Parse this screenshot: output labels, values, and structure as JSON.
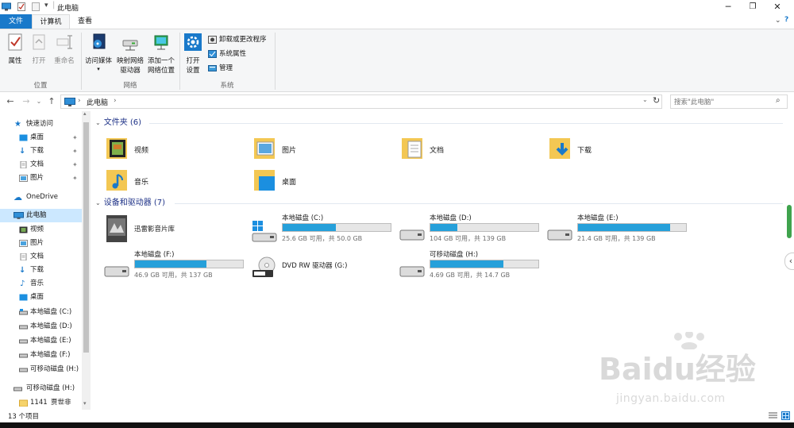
{
  "window": {
    "title": "此电脑"
  },
  "tabs": {
    "file": "文件",
    "computer": "计算机",
    "view": "查看"
  },
  "ribbon": {
    "location": {
      "properties": "属性",
      "open": "打开",
      "rename": "重命名",
      "group": "位置"
    },
    "network": {
      "access_media": "访问媒体",
      "map_drive": "映射网络",
      "map_drive2": "驱动器",
      "add_location": "添加一个",
      "add_location2": "网络位置",
      "group": "网络"
    },
    "system": {
      "open_settings": "打开",
      "open_settings2": "设置",
      "uninstall": "卸载或更改程序",
      "sys_props": "系统属性",
      "manage": "管理",
      "group": "系统"
    }
  },
  "address": {
    "path": "此电脑",
    "separator": "›"
  },
  "search": {
    "placeholder": "搜索\"此电脑\""
  },
  "nav": {
    "quick_access": "快速访问",
    "qa_items": [
      "桌面",
      "下载",
      "文档",
      "图片"
    ],
    "onedrive": "OneDrive",
    "this_pc": "此电脑",
    "pc_items": [
      "视频",
      "图片",
      "文档",
      "下载",
      "音乐",
      "桌面",
      "本地磁盘 (C:)",
      "本地磁盘 (D:)",
      "本地磁盘 (E:)",
      "本地磁盘 (F:)",
      "可移动磁盘 (H:)"
    ],
    "removable": "可移动磁盘 (H:)",
    "folder_1141": "1141",
    "folder_1141_tail": "贾世非"
  },
  "folders": {
    "header": "文件夹 (6)",
    "items": [
      "视频",
      "图片",
      "文档",
      "下载",
      "音乐",
      "桌面"
    ]
  },
  "devices": {
    "header": "设备和驱动器 (7)",
    "xunlei": "迅雷影音片库",
    "drives": [
      {
        "name": "本地磁盘 (C:)",
        "free": "25.6 GB 可用，共 50.0 GB",
        "used_fraction": 0.49
      },
      {
        "name": "本地磁盘 (D:)",
        "free": "104 GB 可用，共 139 GB",
        "used_fraction": 0.25
      },
      {
        "name": "本地磁盘 (E:)",
        "free": "21.4 GB 可用，共 139 GB",
        "used_fraction": 0.85
      },
      {
        "name": "本地磁盘 (F:)",
        "free": "46.9 GB 可用，共 137 GB",
        "used_fraction": 0.66
      },
      {
        "name": "可移动磁盘 (H:)",
        "free": "4.69 GB 可用，共 14.7 GB",
        "used_fraction": 0.68
      }
    ],
    "dvd": "DVD RW 驱动器 (G:)"
  },
  "status": {
    "count": "13 个项目"
  },
  "watermark": {
    "logo": "Baidu经验",
    "url": "jingyan.baidu.com"
  },
  "colors": {
    "accent": "#1979ca",
    "bar_fill": "#26a0da",
    "header_text": "#1e3287"
  }
}
